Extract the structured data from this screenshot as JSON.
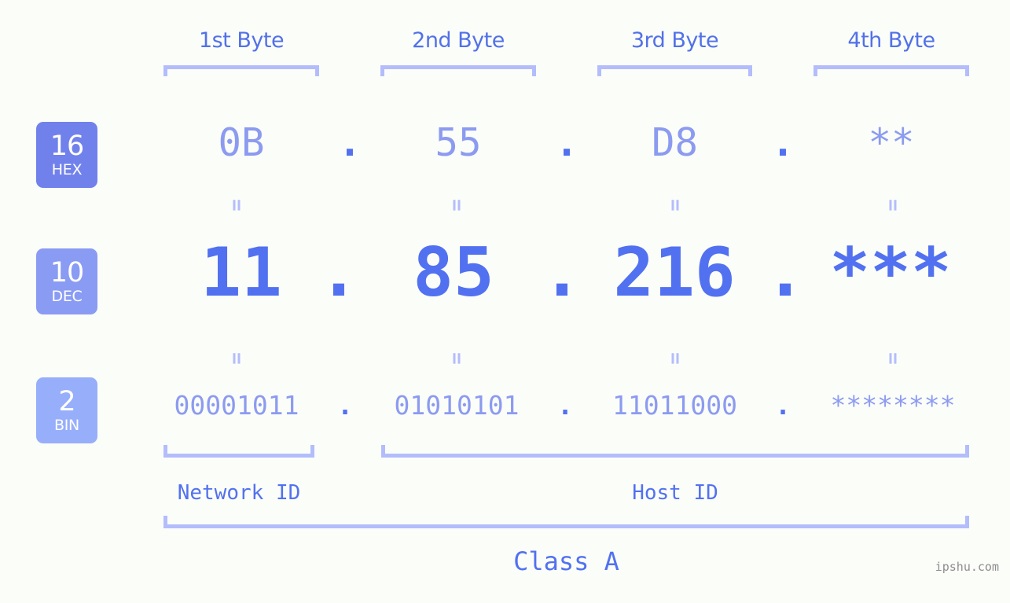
{
  "colors": {
    "background": "#fbfdf9",
    "bracket": "#b4bdfb",
    "header_text": "#5271e8",
    "hex_text": "#8c9bf0",
    "dec_text": "#5271f0",
    "bin_text": "#8c9bf0",
    "dot": "#5271f0",
    "badge_hex": "#7181ec",
    "badge_dec": "#8a9bf3",
    "badge_bin": "#97aefa",
    "watermark": "#8e8e8e"
  },
  "byte_headers": [
    {
      "label": "1st Byte"
    },
    {
      "label": "2nd Byte"
    },
    {
      "label": "3rd Byte"
    },
    {
      "label": "4th Byte"
    }
  ],
  "bases": [
    {
      "number": "16",
      "name": "HEX"
    },
    {
      "number": "10",
      "name": "DEC"
    },
    {
      "number": "2",
      "name": "BIN"
    }
  ],
  "rows": {
    "hex": {
      "values": [
        "0B",
        "55",
        "D8",
        "**"
      ],
      "separator": "."
    },
    "dec": {
      "values": [
        "11",
        "85",
        "216",
        "***"
      ],
      "separator": "."
    },
    "bin": {
      "values": [
        "00001011",
        "01010101",
        "11011000",
        "********"
      ],
      "separator": "."
    }
  },
  "equals_separator": "=",
  "segments": [
    {
      "label": "Network ID"
    },
    {
      "label": "Host ID"
    }
  ],
  "class": {
    "label": "Class A"
  },
  "watermark": {
    "text": "ipshu.com"
  }
}
